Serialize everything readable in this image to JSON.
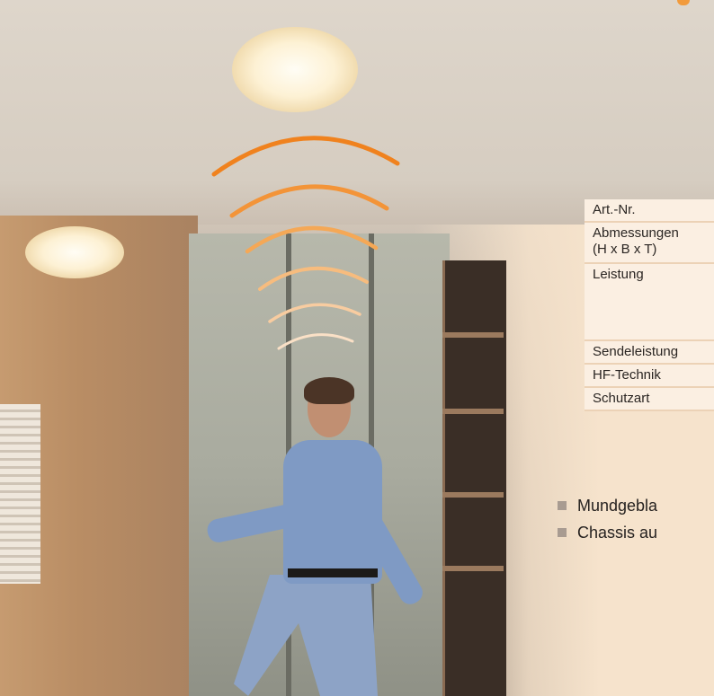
{
  "spec_table": {
    "rows": [
      {
        "label": "Art.-Nr."
      },
      {
        "label": "Abmessungen",
        "label_line2": "(H x B x T)"
      },
      {
        "label": "Leistung"
      },
      {
        "label": "Sendeleistung"
      },
      {
        "label": "HF-Technik"
      },
      {
        "label": "Schutzart"
      }
    ]
  },
  "bullets": [
    {
      "text": "Mundgebla"
    },
    {
      "text": "Chassis au"
    }
  ],
  "colors": {
    "accent_orange": "#f0821e",
    "page_background": "#f6e3cc",
    "table_background": "#fbefe2",
    "bullet_square": "#a89b91"
  },
  "icons": [
    "signal-waves-icon",
    "bullet-square-icon"
  ]
}
